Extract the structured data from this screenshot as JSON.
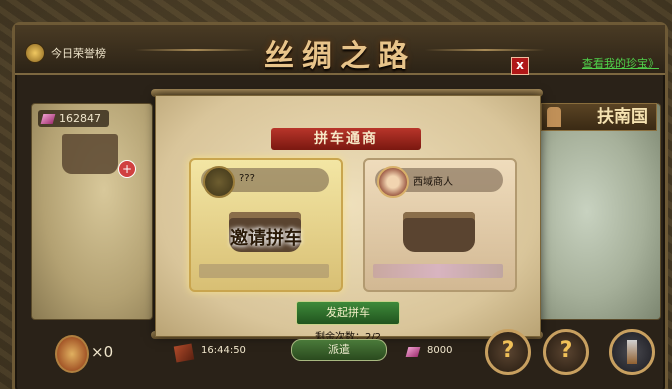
{
  "window": {
    "title": "丝绸之路",
    "honor_label": "今日荣誉榜",
    "treasure_link": "查看我的珍宝》",
    "close_label": "x",
    "country": "扶南国"
  },
  "left_map": {
    "gems": "162847",
    "plus_label": "+"
  },
  "panel": {
    "banner": "拼车通商",
    "left_card": {
      "player_name": "???",
      "invite_text": "邀请拼车"
    },
    "right_card": {
      "player_name": "西域商人"
    },
    "start_button": "发起拼车",
    "remaining": "剩余次数：2/2"
  },
  "bottom": {
    "bag_count": "×0",
    "timer": "16:44:50",
    "dispatch_button": "派遣",
    "gems": "8000",
    "help_label_1": "?",
    "help_label_2": "?"
  },
  "colors": {
    "accent_gold": "#e8c48a",
    "link_green": "#50d04a",
    "button_green": "#3e8a3a",
    "close_red": "#b01818"
  },
  "icons": [
    "medal-icon",
    "gem-icon",
    "plus-icon",
    "tower-icon",
    "bag-icon",
    "book-icon",
    "question-icon",
    "lighthouse-icon",
    "cart-icon",
    "avatar"
  ]
}
